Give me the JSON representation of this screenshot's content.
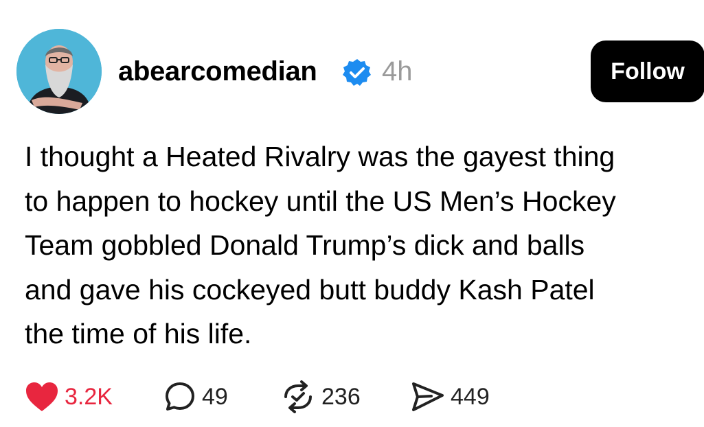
{
  "post": {
    "username": "abearcomedian",
    "verified_icon": "verified-badge-icon",
    "time_ago": "4h",
    "follow_label": "Follow",
    "text": "I thought a Heated Rivalry was the gayest thing\nto happen to hockey until the US Men’s Hockey\nTeam gobbled Donald Trump’s dick and balls\nand gave his cockeyed butt buddy Kash Patel\nthe time of his life."
  },
  "actions": {
    "likes": "3.2K",
    "replies": "49",
    "reposts": "236",
    "shares": "449"
  },
  "colors": {
    "like": "#e8263f",
    "verified": "#1d8cf0",
    "follow_bg": "#000000",
    "time": "#9a9a9a"
  }
}
